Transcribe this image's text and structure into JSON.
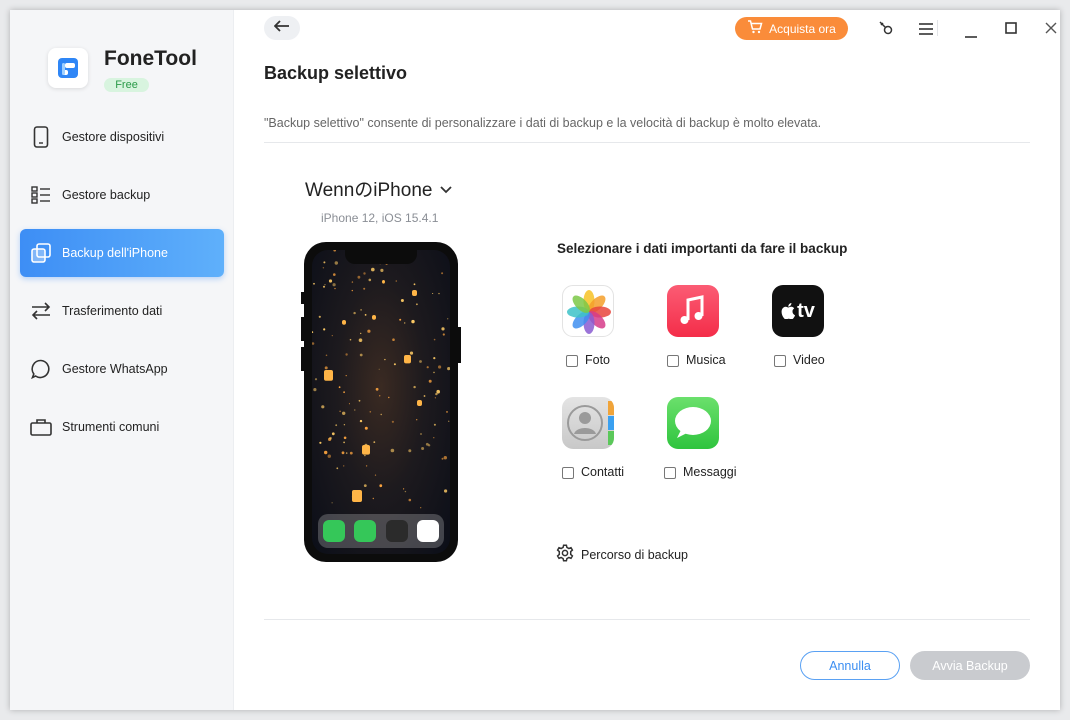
{
  "app": {
    "name": "FoneTool",
    "edition": "Free"
  },
  "sidebar": {
    "items": [
      {
        "label": "Gestore dispositivi",
        "icon": "phone-icon",
        "active": false
      },
      {
        "label": "Gestore backup",
        "icon": "list-icon",
        "active": false
      },
      {
        "label": "Backup dell'iPhone",
        "icon": "copy-icon",
        "active": true
      },
      {
        "label": "Trasferimento dati",
        "icon": "transfer-arrows-icon",
        "active": false
      },
      {
        "label": "Gestore WhatsApp",
        "icon": "chat-bubble-icon",
        "active": false
      },
      {
        "label": "Strumenti comuni",
        "icon": "toolbox-icon",
        "active": false
      }
    ]
  },
  "toolbar": {
    "buy_label": "Acquista ora",
    "icons": [
      "back-arrow-icon",
      "cart-icon",
      "key-icon",
      "menu-icon",
      "minimize-icon",
      "maximize-icon",
      "close-icon"
    ]
  },
  "page": {
    "title": "Backup selettivo",
    "description": "\"Backup selettivo\" consente di personalizzare i dati di backup e la velocità di backup è molto elevata."
  },
  "device": {
    "name": "WennのiPhone",
    "model": "iPhone 12, iOS 15.4.1"
  },
  "selection": {
    "title": "Selezionare i dati importanti da fare il backup",
    "categories": [
      {
        "label": "Foto",
        "icon": "photos-app-icon",
        "checked": false
      },
      {
        "label": "Musica",
        "icon": "music-app-icon",
        "checked": false
      },
      {
        "label": "Video",
        "icon": "apple-tv-app-icon",
        "checked": false,
        "icon_text": "tv"
      },
      {
        "label": "Contatti",
        "icon": "contacts-app-icon",
        "checked": false
      },
      {
        "label": "Messaggi",
        "icon": "messages-app-icon",
        "checked": false
      }
    ]
  },
  "backup_path_label": "Percorso di backup",
  "buttons": {
    "cancel": "Annulla",
    "start": "Avvia Backup"
  },
  "colors": {
    "accent": "#3d8ef5",
    "buy": "#fa8c3a",
    "disabled": "#c9cbcf",
    "free_badge_bg": "#d8f4df",
    "free_badge_text": "#2a9a48"
  }
}
